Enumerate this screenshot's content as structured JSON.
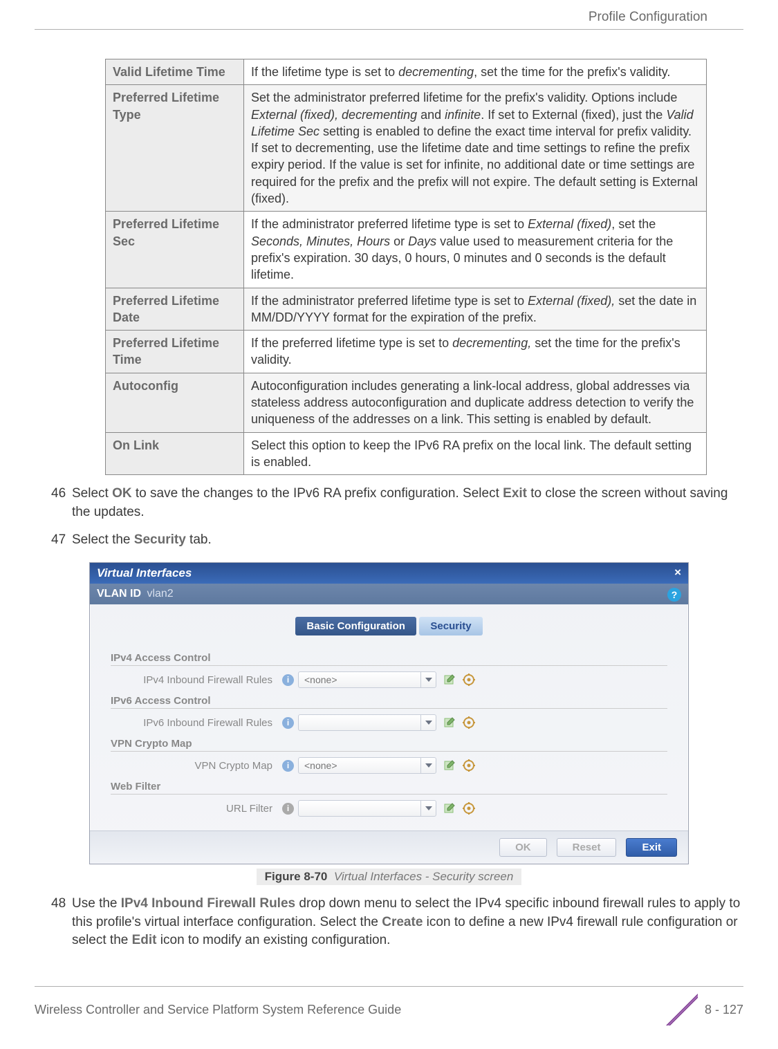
{
  "header": {
    "section": "Profile Configuration"
  },
  "table": [
    {
      "k": "Valid Lifetime Time",
      "v": "If the lifetime type is set to <em class=\"i\">decrementing</em>, set the time for the prefix's validity."
    },
    {
      "k": "Preferred Lifetime Type",
      "v": "Set the administrator preferred lifetime for the prefix's validity. Options include <em class=\"i\">External (fixed), decrementing</em> and <em class=\"i\">infinite</em>. If set to External (fixed), just the <em class=\"i\">Valid Lifetime Sec</em> setting is enabled to define the exact time interval for prefix validity. If set to decrementing, use the lifetime date and time settings to refine the prefix expiry period. If the value is set for infinite, no additional date or time settings are required for the prefix and the prefix will not expire. The default setting is External (fixed)."
    },
    {
      "k": "Preferred Lifetime Sec",
      "v": "If the administrator preferred lifetime type is set to <em class=\"i\">External (fixed)</em>, set the <em class=\"i\">Seconds, Minutes, Hours</em> or <em class=\"i\">Days</em> value used to measurement criteria for the prefix's expiration. 30 days, 0 hours, 0 minutes and 0 seconds is the default lifetime."
    },
    {
      "k": "Preferred Lifetime Date",
      "v": "If the administrator preferred lifetime type is set to <em class=\"i\">External (fixed),</em> set the date in MM/DD/YYYY format for the expiration of the prefix."
    },
    {
      "k": "Preferred Lifetime Time",
      "v": "If the preferred lifetime type is set to <em class=\"i\">decrementing,</em> set the time for the prefix's validity."
    },
    {
      "k": "Autoconfig",
      "v": "Autoconfiguration includes generating a link-local address, global addresses via stateless address autoconfiguration and duplicate address detection to verify the uniqueness of the addresses on a link. This setting is enabled by default."
    },
    {
      "k": "On Link",
      "v": "Select this option to keep the IPv6 RA prefix on the local link. The default setting is enabled."
    }
  ],
  "steps": {
    "s46": {
      "num": "46",
      "text": "Select <b>OK</b> to save the changes to the IPv6 RA prefix configuration. Select <b>Exit</b> to close the screen without saving the updates."
    },
    "s47": {
      "num": "47",
      "text": "Select the <b>Security</b> tab."
    },
    "s48": {
      "num": "48",
      "text": "Use the <b>IPv4 Inbound Firewall Rules</b> drop down menu to select the IPv4 specific inbound firewall rules to apply to this profile's virtual interface configuration. Select the <b>Create</b> icon to define a new IPv4 firewall rule configuration or select the <b>Edit</b> icon to modify an existing configuration."
    }
  },
  "dialog": {
    "title": "Virtual Interfaces",
    "vlan_label": "VLAN ID",
    "vlan_value": "vlan2",
    "tabs": {
      "basic": "Basic Configuration",
      "security": "Security"
    },
    "groups": {
      "ipv4": {
        "hdr": "IPv4 Access Control",
        "row": "IPv4 Inbound Firewall Rules",
        "val": "<none>"
      },
      "ipv6": {
        "hdr": "IPv6 Access Control",
        "row": "IPv6 Inbound Firewall Rules",
        "val": ""
      },
      "vpn": {
        "hdr": "VPN Crypto Map",
        "row": "VPN Crypto Map",
        "val": "<none>"
      },
      "web": {
        "hdr": "Web Filter",
        "row": "URL Filter",
        "val": ""
      }
    },
    "buttons": {
      "ok": "OK",
      "reset": "Reset",
      "exit": "Exit"
    }
  },
  "figure": {
    "label": "Figure 8-70",
    "caption": "Virtual Interfaces - Security screen"
  },
  "footer": {
    "guide": "Wireless Controller and Service Platform System Reference Guide",
    "page": "8 - 127"
  }
}
